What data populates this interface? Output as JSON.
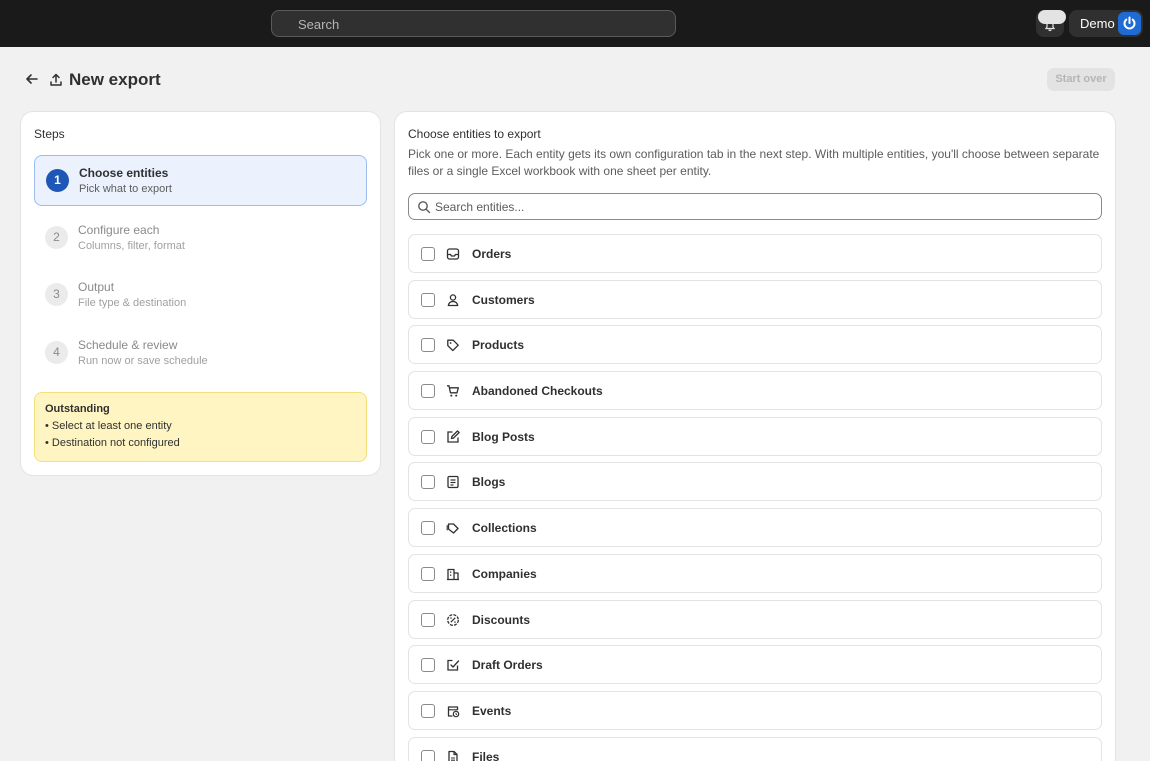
{
  "topbar": {
    "search_placeholder": "Search",
    "user_name": "Demo",
    "icons": {
      "notifications": "bell-icon",
      "avatar": "power-icon"
    }
  },
  "header": {
    "title": "New export",
    "start_over_label": "Start over",
    "icons": {
      "back": "arrow-left-icon",
      "export": "export-icon"
    }
  },
  "steps": {
    "heading": "Steps",
    "items": [
      {
        "number": "1",
        "name": "Choose entities",
        "description": "Pick what to export",
        "active": true
      },
      {
        "number": "2",
        "name": "Configure each",
        "description": "Columns, filter, format",
        "active": false
      },
      {
        "number": "3",
        "name": "Output",
        "description": "File type & destination",
        "active": false
      },
      {
        "number": "4",
        "name": "Schedule & review",
        "description": "Run now or save schedule",
        "active": false
      }
    ],
    "outstanding": {
      "heading": "Outstanding",
      "items": [
        "• Select at least one entity",
        "• Destination not configured"
      ]
    }
  },
  "entities": {
    "title": "Choose entities to export",
    "description": "Pick one or more. Each entity gets its own configuration tab in the next step. With multiple entities, you'll choose between separate files or a single Excel workbook with one sheet per entity.",
    "search_placeholder": "Search entities...",
    "items": [
      {
        "label": "Orders",
        "icon": "inbox-icon",
        "checked": false
      },
      {
        "label": "Customers",
        "icon": "person-icon",
        "checked": false
      },
      {
        "label": "Products",
        "icon": "tag-icon",
        "checked": false
      },
      {
        "label": "Abandoned Checkouts",
        "icon": "cart-icon",
        "checked": false
      },
      {
        "label": "Blog Posts",
        "icon": "edit-icon",
        "checked": false
      },
      {
        "label": "Blogs",
        "icon": "blog-icon",
        "checked": false
      },
      {
        "label": "Collections",
        "icon": "collection-icon",
        "checked": false
      },
      {
        "label": "Companies",
        "icon": "building-icon",
        "checked": false
      },
      {
        "label": "Discounts",
        "icon": "discount-icon",
        "checked": false
      },
      {
        "label": "Draft Orders",
        "icon": "draft-order-icon",
        "checked": false
      },
      {
        "label": "Events",
        "icon": "calendar-icon",
        "checked": false
      },
      {
        "label": "Files",
        "icon": "file-icon",
        "checked": false
      }
    ]
  }
}
